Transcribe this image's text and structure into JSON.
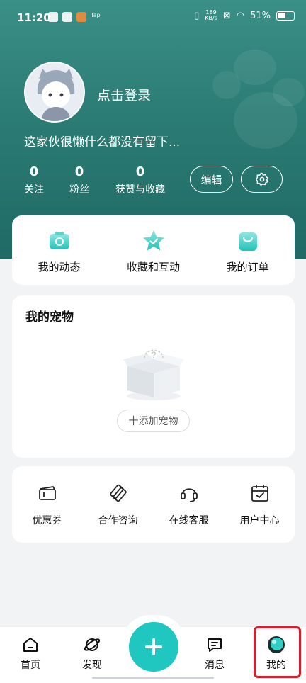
{
  "status_bar": {
    "time": "11:20",
    "speed_value": "189",
    "speed_unit": "KB/s",
    "battery": "51%"
  },
  "profile": {
    "login_prompt": "点击登录",
    "bio": "这家伙很懒什么都没有留下...",
    "stats": [
      {
        "value": "0",
        "label": "关注"
      },
      {
        "value": "0",
        "label": "粉丝"
      },
      {
        "value": "0",
        "label": "获赞与收藏"
      }
    ],
    "edit_label": "编辑"
  },
  "quick_actions": [
    {
      "label": "我的动态",
      "icon": "camera-icon"
    },
    {
      "label": "收藏和互动",
      "icon": "star-icon"
    },
    {
      "label": "我的订单",
      "icon": "shopping-bag-icon"
    }
  ],
  "pets": {
    "title": "我的宠物",
    "add_label": "十添加宠物"
  },
  "services": [
    {
      "label": "优惠券",
      "icon": "ticket-icon"
    },
    {
      "label": "合作咨询",
      "icon": "handshake-icon"
    },
    {
      "label": "在线客服",
      "icon": "headset-icon"
    },
    {
      "label": "用户中心",
      "icon": "calendar-check-icon"
    }
  ],
  "tabbar": [
    {
      "label": "首页",
      "icon": "home-icon"
    },
    {
      "label": "发现",
      "icon": "planet-icon"
    },
    {
      "label": "消息",
      "icon": "message-icon"
    },
    {
      "label": "我的",
      "icon": "profile-icon"
    }
  ],
  "colors": {
    "accent": "#1fc7c0",
    "header": "#2b7c74",
    "highlight": "#d81e2a"
  }
}
